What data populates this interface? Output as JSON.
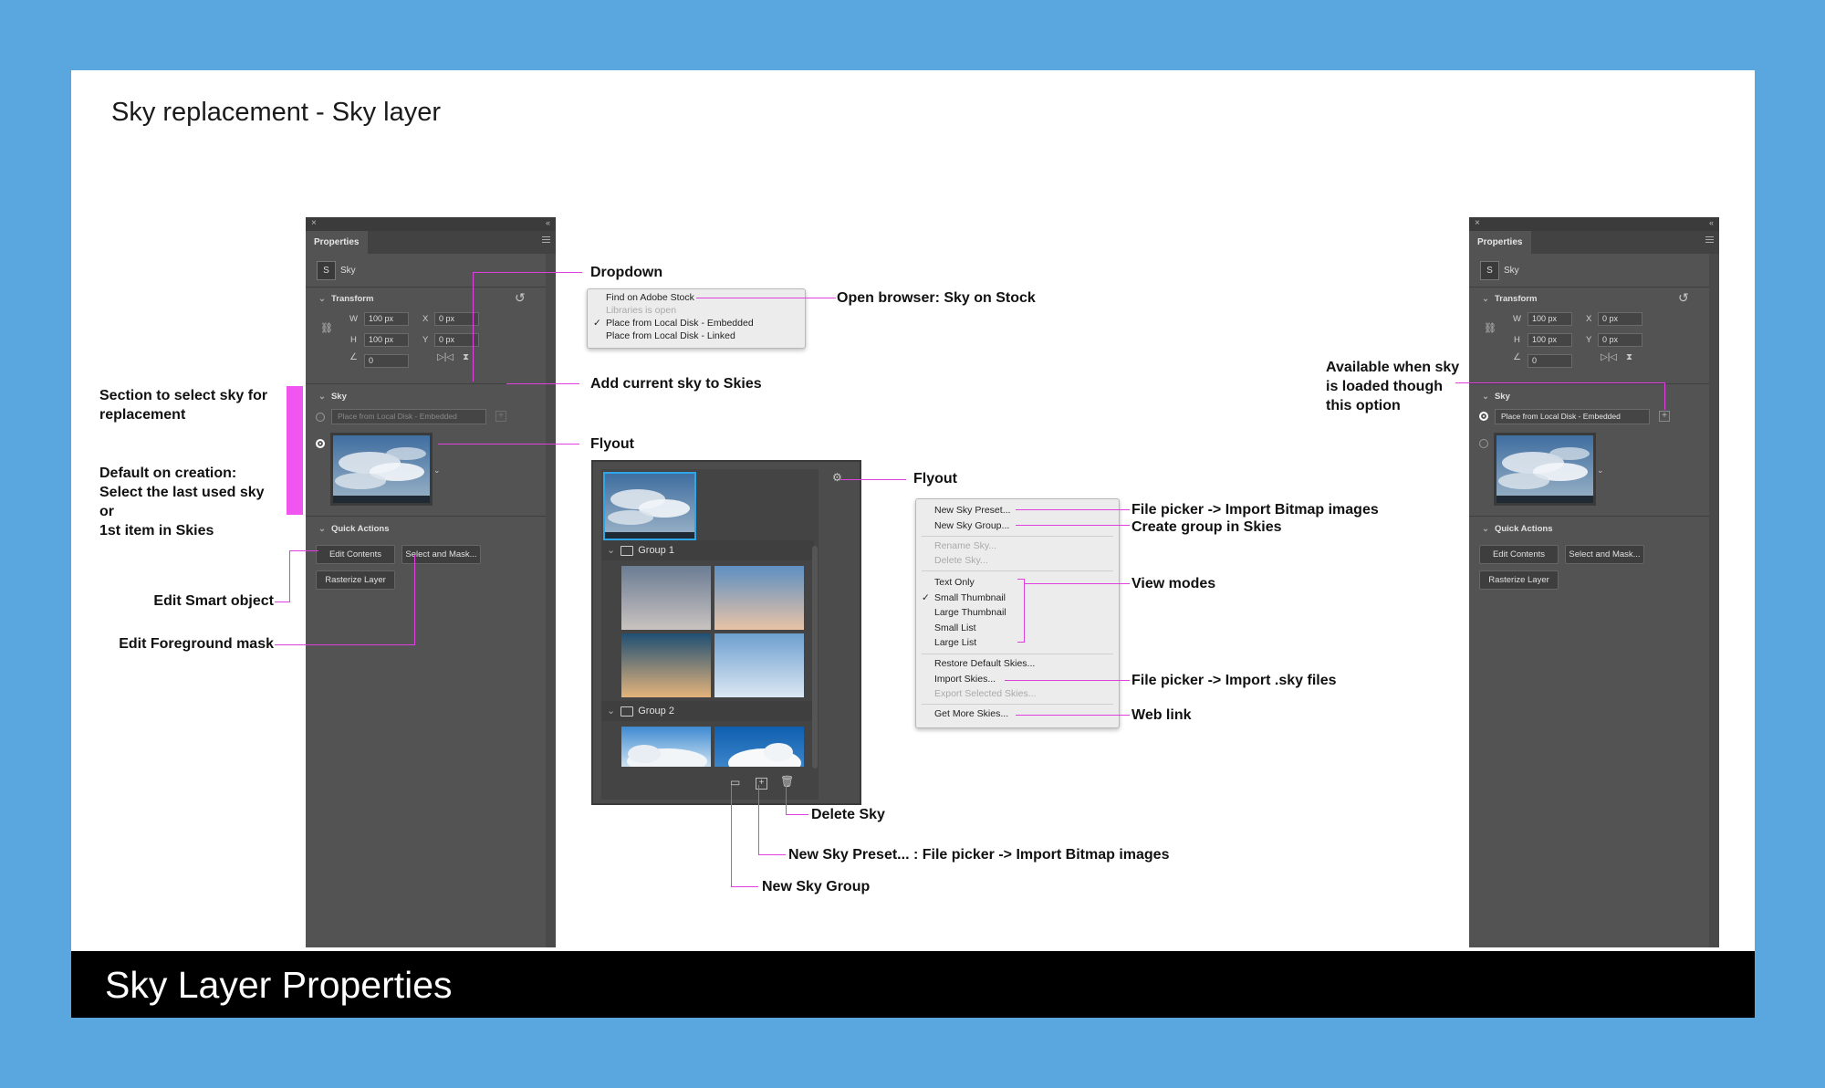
{
  "slide": {
    "title": "Sky replacement - Sky layer",
    "footer": "Sky Layer Properties"
  },
  "panel": {
    "tab": "Properties",
    "layer_badge": "S",
    "layer_name": "Sky",
    "transform_label": "Transform",
    "w_label": "W",
    "w_value": "100 px",
    "h_label": "H",
    "h_value": "100 px",
    "x_label": "X",
    "x_value": "0 px",
    "y_label": "Y",
    "y_value": "0 px",
    "angle_value": "0",
    "sky_label": "Sky",
    "sky_dropdown": "Place from Local Disk - Embedded",
    "quick_actions_label": "Quick Actions",
    "edit_contents": "Edit Contents",
    "select_mask": "Select and Mask...",
    "rasterize": "Rasterize Layer"
  },
  "dropdown_menu": {
    "items": [
      {
        "label": "Find on Adobe Stock",
        "disabled": false,
        "checked": false
      },
      {
        "label": "Libraries is open",
        "disabled": true,
        "checked": false
      },
      {
        "label": "Place from Local Disk - Embedded",
        "disabled": false,
        "checked": true
      },
      {
        "label": "Place from Local Disk - Linked",
        "disabled": false,
        "checked": false
      }
    ],
    "check": "✓"
  },
  "flyout": {
    "group1": "Group 1",
    "group2": "Group 2"
  },
  "flyout_menu": {
    "items": [
      {
        "label": "New Sky Preset...",
        "disabled": false,
        "checked": false
      },
      {
        "label": "New Sky Group...",
        "disabled": false,
        "checked": false
      },
      {
        "label": "Rename Sky...",
        "disabled": true,
        "checked": false
      },
      {
        "label": "Delete Sky...",
        "disabled": true,
        "checked": false
      },
      {
        "label": "Text Only",
        "disabled": false,
        "checked": false
      },
      {
        "label": "Small Thumbnail",
        "disabled": false,
        "checked": true
      },
      {
        "label": "Large Thumbnail",
        "disabled": false,
        "checked": false
      },
      {
        "label": "Small List",
        "disabled": false,
        "checked": false
      },
      {
        "label": "Large List",
        "disabled": false,
        "checked": false
      },
      {
        "label": "Restore Default Skies...",
        "disabled": false,
        "checked": false
      },
      {
        "label": "Import Skies...",
        "disabled": false,
        "checked": false
      },
      {
        "label": "Export Selected Skies...",
        "disabled": true,
        "checked": false
      },
      {
        "label": "Get More Skies...",
        "disabled": false,
        "checked": false
      }
    ],
    "check": "✓"
  },
  "annotations": {
    "dropdown": "Dropdown",
    "open_browser": "Open browser: Sky on Stock",
    "add_current": "Add current sky to Skies",
    "flyout_1": "Flyout",
    "flyout_2": "Flyout",
    "section_select_1": "Section to select sky for",
    "section_select_2": "replacement",
    "default_1": "Default on creation:",
    "default_2": "Select the last used sky",
    "default_3": "or",
    "default_4": "1st item in Skies",
    "edit_smart": "Edit Smart object",
    "edit_fg": "Edit Foreground mask",
    "file_picker_bitmap": "File picker -> Import Bitmap images",
    "create_group": "Create group in Skies",
    "view_modes": "View modes",
    "file_picker_sky": "File picker -> Import .sky files",
    "web_link": "Web link",
    "delete_sky": "Delete Sky",
    "new_preset": "New Sky Preset... : File picker -> Import Bitmap images",
    "new_group": "New Sky Group",
    "available_1": "Available when sky",
    "available_2": "is loaded though",
    "available_3": "this option"
  },
  "colors": {
    "background": "#5aa6df",
    "annotation_line": "#e040e0",
    "panel": "#535353"
  }
}
